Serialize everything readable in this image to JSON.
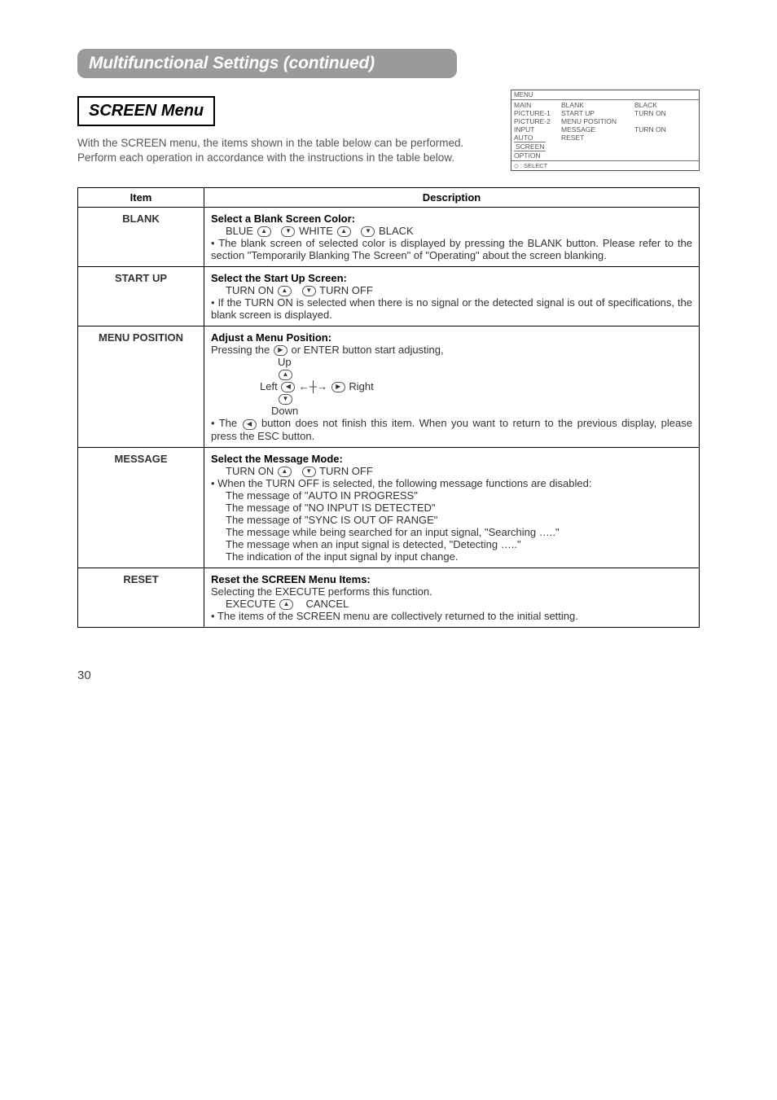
{
  "title_bar": "Multifunctional Settings (continued)",
  "menu_label": "SCREEN Menu",
  "intro1": "With the SCREEN menu, the items shown in the table below can be performed.",
  "intro2": "Perform each operation in accordance with the instructions in the table below.",
  "mini_menu": {
    "header": "MENU",
    "rows": [
      {
        "c1": "MAIN",
        "c2": "BLANK",
        "c3": "BLACK"
      },
      {
        "c1": "PICTURE-1",
        "c2": "START UP",
        "c3": "TURN ON"
      },
      {
        "c1": "PICTURE-2",
        "c2": "MENU POSITION",
        "c3": ""
      },
      {
        "c1": "INPUT",
        "c2": "MESSAGE",
        "c3": "TURN ON"
      },
      {
        "c1": "AUTO",
        "c2": "RESET",
        "c3": ""
      }
    ],
    "screen_row": "SCREEN",
    "option_row": "OPTION",
    "footer": ": SELECT"
  },
  "table": {
    "h1": "Item",
    "h2": "Description",
    "blank": {
      "name": "BLANK",
      "head": "Select a Blank Screen Color:",
      "line": {
        "a": "BLUE",
        "b": "WHITE",
        "c": "BLACK"
      },
      "bullet": "• The blank screen of selected color is displayed by pressing the BLANK button. Please refer to the section \"Temporarily Blanking The Screen\" of \"Operating\" about the screen blanking."
    },
    "startup": {
      "name": "START UP",
      "head": "Select the Start Up Screen:",
      "line": {
        "a": "TURN ON",
        "b": "TURN OFF"
      },
      "bullet": "• If the TURN ON is selected when there is no signal or the detected signal is out of specifications, the blank screen is displayed."
    },
    "menupos": {
      "name": "MENU POSITION",
      "head": "Adjust a Menu Position:",
      "press": "Pressing the ",
      "press2": " or ENTER button start adjusting,",
      "up": "Up",
      "left": "Left",
      "right": "Right",
      "down": "Down",
      "bullet": "• The      button does not finish this item. When you want to return to the previous display, please press the ESC button.",
      "bullet_a": "• The ",
      "bullet_b": " button does not finish this item. When you want to return to the previous display, please press the ESC button."
    },
    "message": {
      "name": "MESSAGE",
      "head": "Select the Message Mode:",
      "line": {
        "a": "TURN ON",
        "b": "TURN OFF"
      },
      "b1": "• When the TURN OFF is selected, the following message functions are disabled:",
      "m1": "The message of \"AUTO IN PROGRESS\"",
      "m2": "The message of \"NO INPUT IS DETECTED\"",
      "m3": "The message of \"SYNC IS OUT OF RANGE\"",
      "m4": "The message while being searched for an input signal, \"Searching …..\"",
      "m5": "The message when an input signal is detected, \"Detecting …..\"",
      "m6": "The indication of the input signal by input change."
    },
    "reset": {
      "name": "RESET",
      "head": "Reset the SCREEN Menu Items:",
      "sel": "Selecting the EXECUTE performs this function.",
      "line": {
        "a": "EXECUTE",
        "b": "CANCEL"
      },
      "bullet": "• The items of the SCREEN menu are collectively returned to the initial setting."
    }
  },
  "pagenum": "30"
}
